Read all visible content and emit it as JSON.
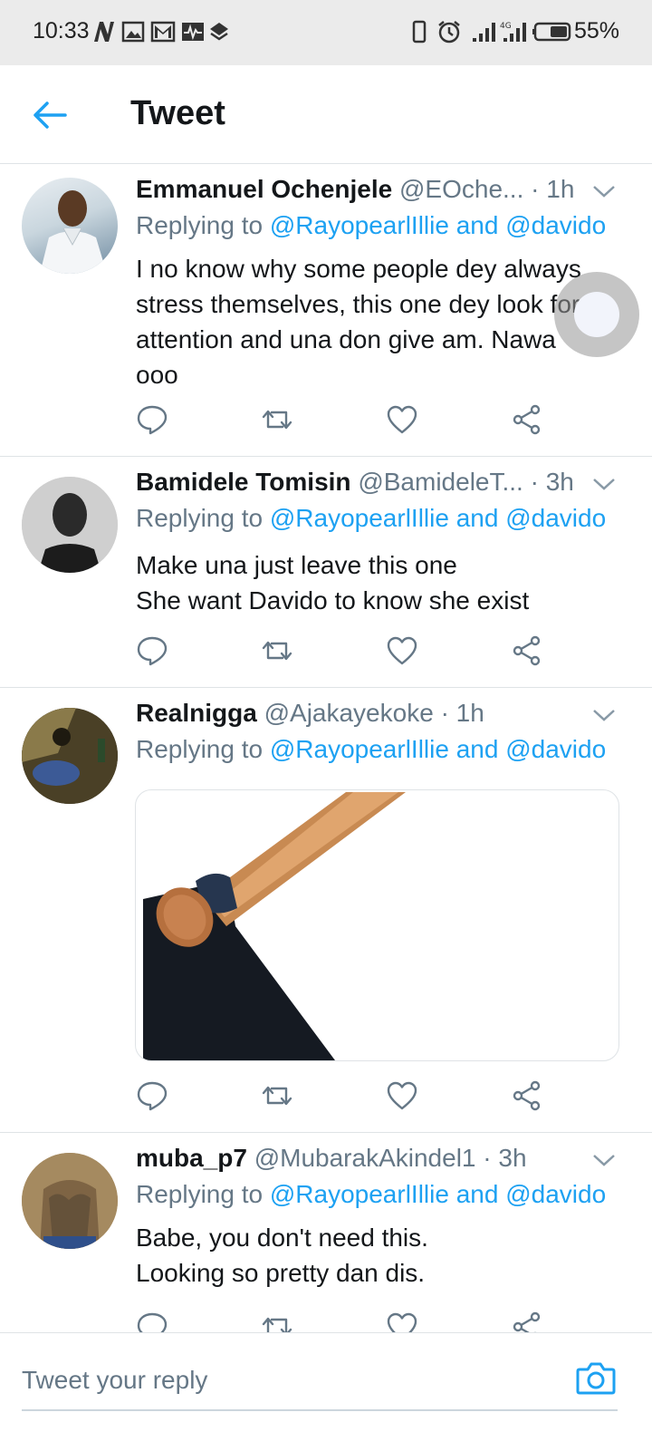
{
  "status_bar": {
    "time": "10:33",
    "battery_percent": "55%",
    "notification_icons": [
      "n-app-icon",
      "image-icon",
      "gmail-icon",
      "pulse-icon",
      "layers-icon"
    ],
    "right_icons": [
      "phone-outline-icon",
      "alarm-icon",
      "signal-icon",
      "signal-4g-icon",
      "battery-icon"
    ]
  },
  "header": {
    "title": "Tweet",
    "back_icon": "back-arrow-icon"
  },
  "colors": {
    "accent": "#1da1f2",
    "secondary_text": "#657786",
    "divider": "#dfe3e6"
  },
  "tweets": [
    {
      "name": "Emmanuel Ochenjele",
      "handle": "@EOche...",
      "time": "· 1h",
      "replying_prefix": "Replying to ",
      "replying_targets": "@RayopearlIllie and @davido",
      "lines": [
        "I no know why some people dey always",
        "stress themselves, this one dey look for",
        "attention and una don give am. Nawa",
        "ooo"
      ]
    },
    {
      "name": "Bamidele Tomisin",
      "handle": "@BamideleT...",
      "time": "· 3h",
      "replying_prefix": "Replying to ",
      "replying_targets": "@RayopearlIllie and @davido",
      "lines": [
        "Make una just leave this one",
        "She want Davido to know she exist"
      ]
    },
    {
      "name": "Realnigga",
      "handle": "@Ajakayekoke",
      "time": "· 1h",
      "replying_prefix": "Replying to ",
      "replying_targets": "@RayopearlIllie and @davido",
      "media": "hoe-image"
    },
    {
      "name": "muba_p7",
      "handle": "@MubarakAkindel1",
      "time": "· 3h",
      "replying_prefix": "Replying to ",
      "replying_targets": "@RayopearlIllie and @davido",
      "lines": [
        "Babe, you don't need this.",
        "Looking so pretty dan dis."
      ]
    }
  ],
  "action_icons": [
    "reply-icon",
    "retweet-icon",
    "like-icon",
    "share-icon"
  ],
  "reply_bar": {
    "placeholder": "Tweet your reply",
    "camera_icon": "camera-icon"
  }
}
